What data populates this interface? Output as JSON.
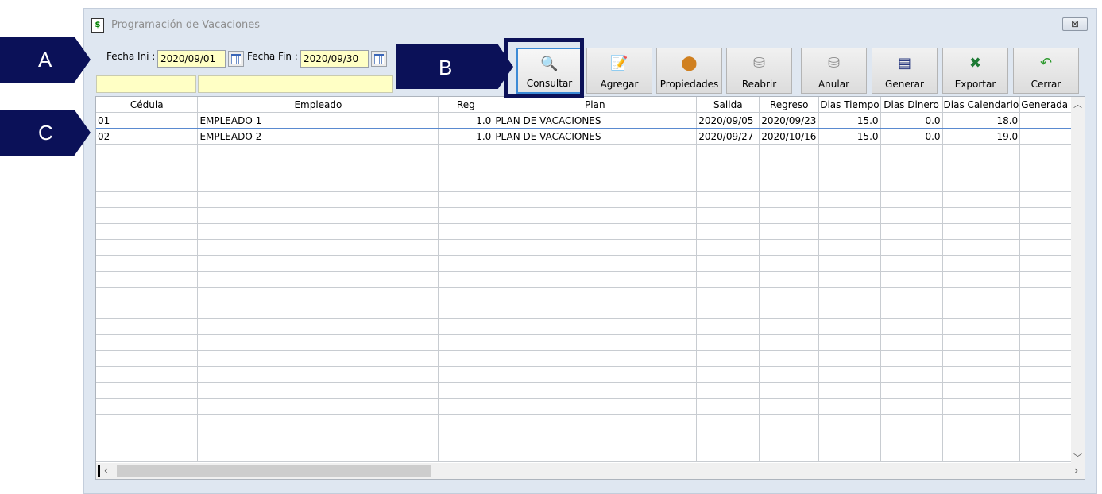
{
  "window": {
    "title": "Programación de Vacaciones",
    "close_glyph": "⊠"
  },
  "filters": {
    "fecha_ini_label": "Fecha Ini :",
    "fecha_ini_value": "2020/09/01",
    "fecha_fin_label": "Fecha Fin :",
    "fecha_fin_value": "2020/09/30"
  },
  "toolbar": [
    {
      "key": "consultar",
      "label": "Consultar",
      "icon": "magnifier-icon",
      "glyph": "🔍",
      "color": "#c0a060"
    },
    {
      "key": "agregar",
      "label": "Agregar",
      "icon": "new-document-icon",
      "glyph": "📝",
      "color": "#3a6fc0"
    },
    {
      "key": "propiedades",
      "label": "Propiedades",
      "icon": "properties-icon",
      "glyph": "⬤",
      "color": "#d08020"
    },
    {
      "key": "reabrir",
      "label": "Reabrir",
      "icon": "reopen-icon",
      "glyph": "⛁",
      "color": "#8a8a8a"
    },
    {
      "key": "anular",
      "label": "Anular",
      "icon": "void-icon",
      "glyph": "⛁",
      "color": "#8a8a8a"
    },
    {
      "key": "generar",
      "label": "Generar",
      "icon": "generate-document-icon",
      "glyph": "▤",
      "color": "#2a3a80"
    },
    {
      "key": "exportar",
      "label": "Exportar",
      "icon": "excel-icon",
      "glyph": "✖",
      "color": "#1d7a35"
    },
    {
      "key": "cerrar",
      "label": "Cerrar",
      "icon": "undo-arrow-icon",
      "glyph": "↶",
      "color": "#2f9a2f"
    }
  ],
  "table": {
    "columns": [
      "Cédula",
      "Empleado",
      "Reg",
      "Plan",
      "Salida",
      "Regreso",
      "Dias Tiempo",
      "Dias Dinero",
      "Dias Calendario",
      "Generada en"
    ],
    "rows": [
      [
        "01",
        "EMPLEADO 1",
        "1.0",
        "PLAN DE VACACIONES",
        "2020/09/05",
        "2020/09/23",
        "15.0",
        "0.0",
        "18.0",
        ""
      ],
      [
        "02",
        "EMPLEADO 2",
        "1.0",
        "PLAN DE VACACIONES",
        "2020/09/27",
        "2020/10/16",
        "15.0",
        "0.0",
        "19.0",
        ""
      ]
    ]
  },
  "callouts": {
    "a": "A",
    "b": "B",
    "c": "C"
  },
  "colors": {
    "callout_bg": "#0b1158",
    "input_bg": "#ffffc5",
    "window_bg": "#dfe7f1",
    "active_border": "#3c8ad6"
  }
}
